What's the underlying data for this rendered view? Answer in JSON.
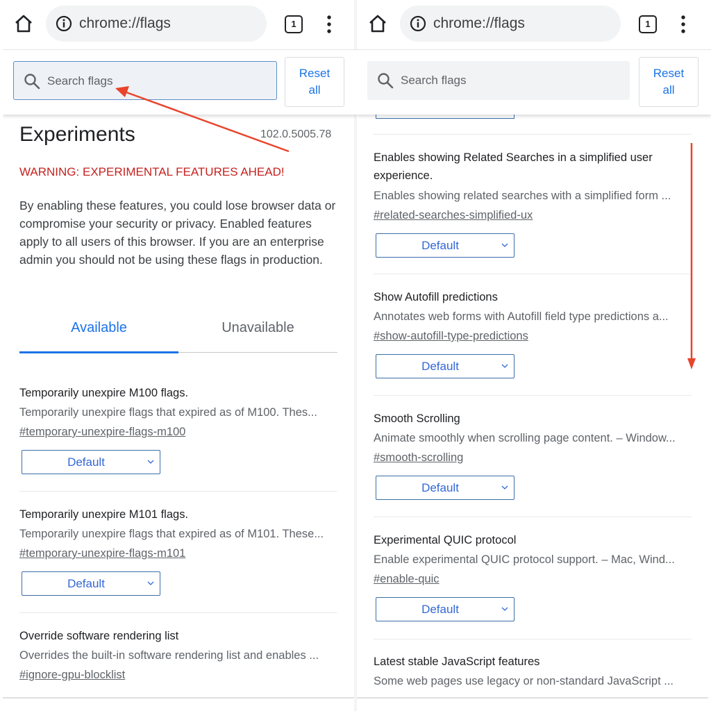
{
  "browser": {
    "url": "chrome://flags",
    "tab_count": "1",
    "icons": [
      "home-icon",
      "info-icon",
      "tab-switcher-icon",
      "more-menu-icon"
    ]
  },
  "search": {
    "placeholder": "Search flags",
    "reset_label": "Reset all"
  },
  "left_page": {
    "title": "Experiments",
    "version": "102.0.5005.78",
    "warning": "WARNING: EXPERIMENTAL FEATURES AHEAD!",
    "intro": "By enabling these features, you could lose browser data or compromise your security or privacy. Enabled features apply to all users of this browser. If you are an enterprise admin you should not be using these flags in production.",
    "tabs": {
      "available": "Available",
      "unavailable": "Unavailable"
    },
    "experiments": [
      {
        "name": "Temporarily unexpire M100 flags.",
        "desc": "Temporarily unexpire flags that expired as of M100. Thes...",
        "link": "#temporary-unexpire-flags-m100",
        "value": "Default"
      },
      {
        "name": "Temporarily unexpire M101 flags.",
        "desc": "Temporarily unexpire flags that expired as of M101. These...",
        "link": "#temporary-unexpire-flags-m101",
        "value": "Default"
      },
      {
        "name": "Override software rendering list",
        "desc": "Overrides the built-in software rendering list and enables ...",
        "link": "#ignore-gpu-blocklist",
        "value": ""
      }
    ]
  },
  "right_page": {
    "experiments": [
      {
        "name": "Enables showing Related Searches in a simplified user experience.",
        "desc": "Enables showing related searches with a simplified form ...",
        "link": "#related-searches-simplified-ux",
        "value": "Default"
      },
      {
        "name": "Show Autofill predictions",
        "desc": "Annotates web forms with Autofill field type predictions a...",
        "link": "#show-autofill-type-predictions",
        "value": "Default"
      },
      {
        "name": "Smooth Scrolling",
        "desc": "Animate smoothly when scrolling page content. – Window...",
        "link": "#smooth-scrolling",
        "value": "Default"
      },
      {
        "name": "Experimental QUIC protocol",
        "desc": "Enable experimental QUIC protocol support. – Mac, Wind...",
        "link": "#enable-quic",
        "value": "Default"
      },
      {
        "name": "Latest stable JavaScript features",
        "desc": "Some web pages use legacy or non-standard JavaScript ...",
        "link": "",
        "value": ""
      }
    ]
  },
  "colors": {
    "accent": "#1a73e8",
    "warning": "#c5221f",
    "annotation_arrow": "#e8452c"
  }
}
